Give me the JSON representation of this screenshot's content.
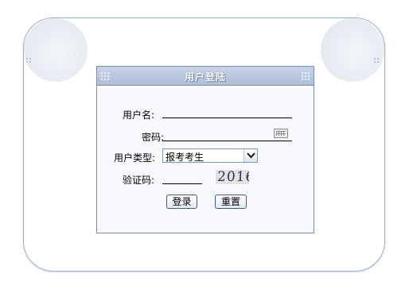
{
  "login_panel": {
    "title": "用户登陆",
    "username_label": "用户名:",
    "username_value": "",
    "password_label": "密码:",
    "password_value": "",
    "user_type_label": "用户类型:",
    "user_type_selected": "报考考生",
    "captcha_label": "验证码:",
    "captcha_value": "",
    "captcha_image_text": "2016",
    "login_button": "登录",
    "reset_button": "重置"
  },
  "colors": {
    "header_gradient_top": "#c9d4e6",
    "header_gradient_bottom": "#aebdd6",
    "panel_border": "#7a8fb0",
    "button_border": "#3c5d8a"
  },
  "icons": {
    "keyboard": "soft-keyboard-icon",
    "dropdown": "chevron-down-icon"
  }
}
